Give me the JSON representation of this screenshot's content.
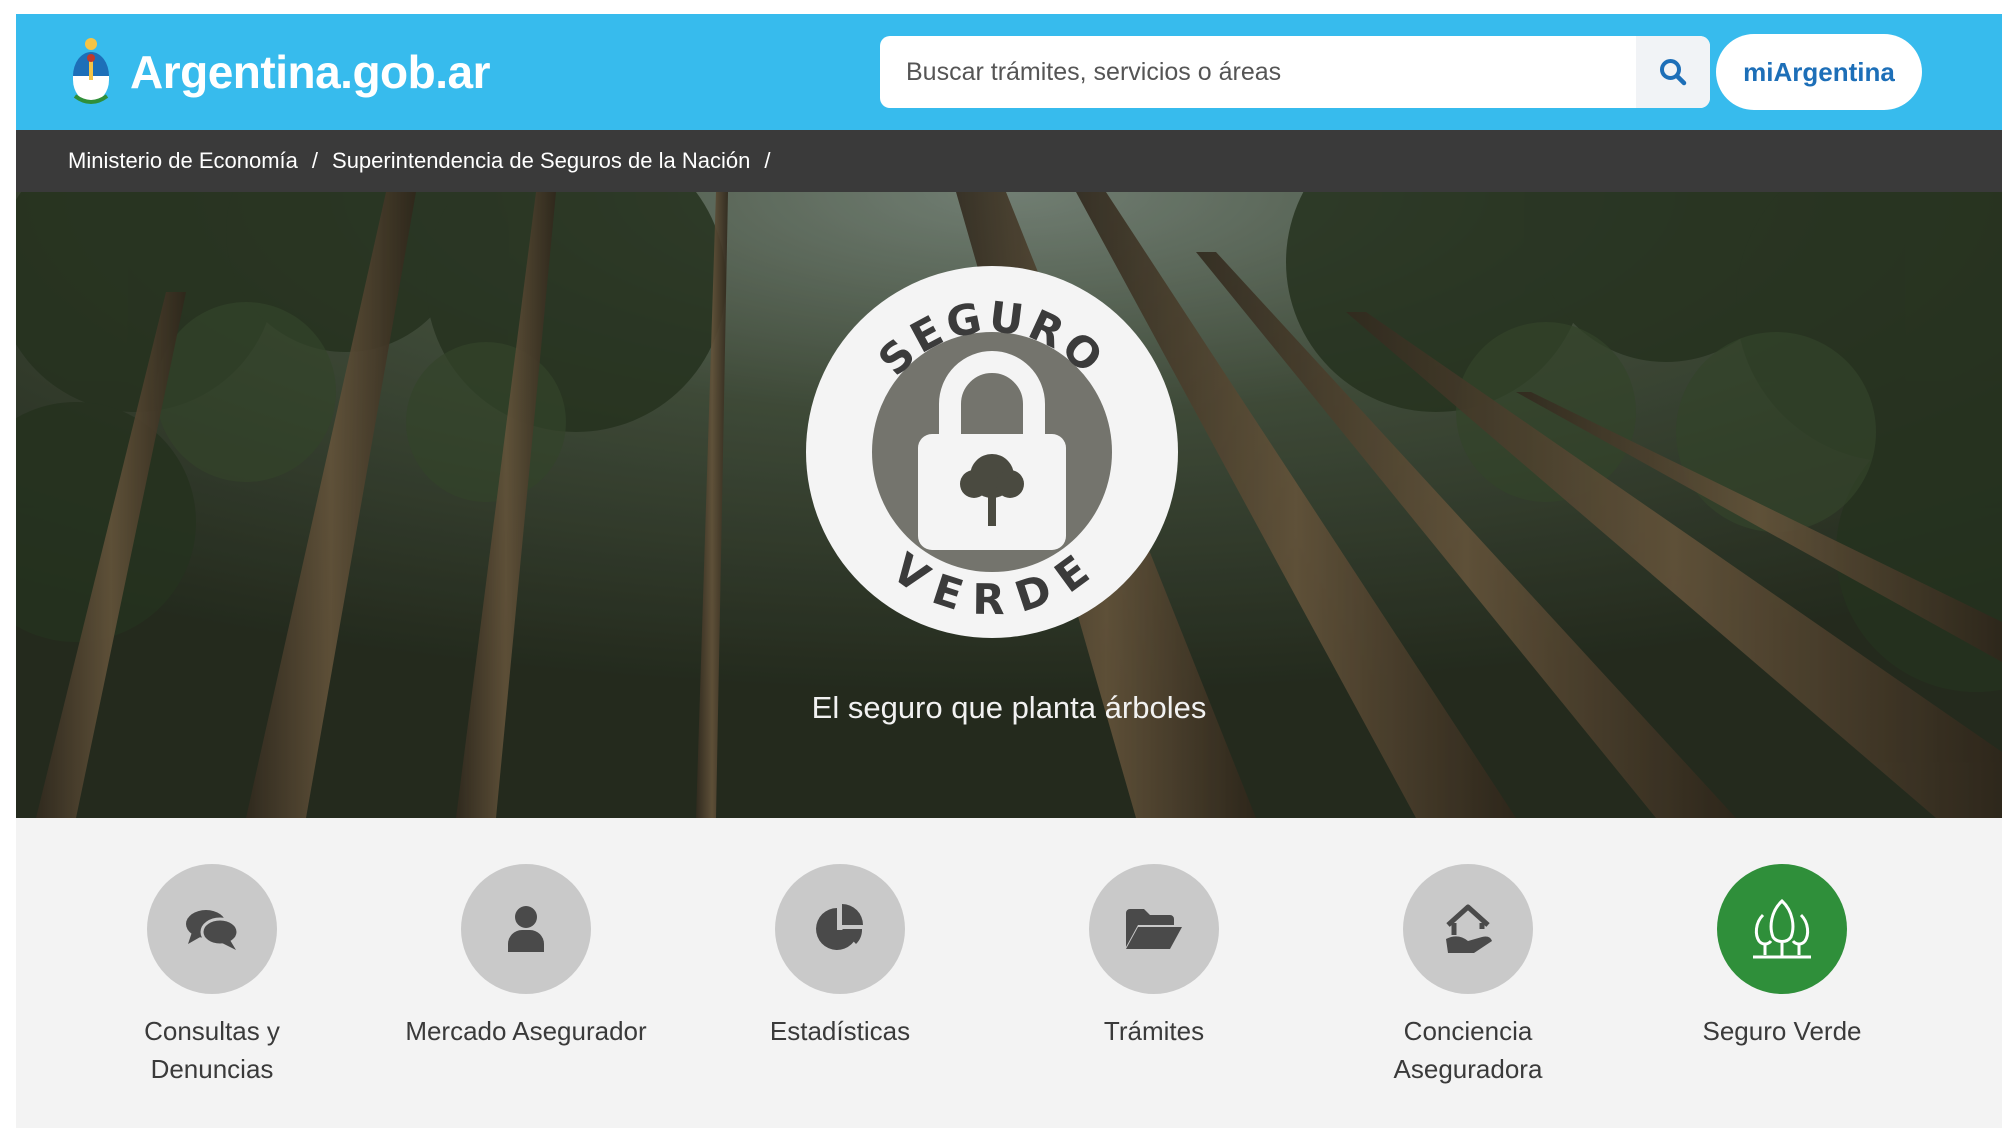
{
  "header": {
    "brand": "Argentina.gob.ar",
    "search_placeholder": "Buscar trámites, servicios o áreas",
    "login_label": "miArgentina"
  },
  "breadcrumb": {
    "items": [
      "Ministerio de Economía",
      "Superintendencia de Seguros de la Nación"
    ],
    "separator": "/"
  },
  "hero": {
    "badge_top": "SEGURO",
    "badge_bottom": "VERDE",
    "caption": "El seguro que planta árboles"
  },
  "quick_links": {
    "items": [
      {
        "label": "Consultas y Denuncias",
        "icon": "chat-icon"
      },
      {
        "label": "Mercado Asegurador",
        "icon": "user-icon"
      },
      {
        "label": "Estadísticas",
        "icon": "pie-chart-icon"
      },
      {
        "label": "Trámites",
        "icon": "folder-open-icon"
      },
      {
        "label": "Conciencia Aseguradora",
        "icon": "house-hand-icon"
      },
      {
        "label": "Seguro Verde",
        "icon": "trees-icon"
      }
    ]
  },
  "colors": {
    "header_bg": "#37bbed",
    "breadcrumb_bg": "#3a3a3a",
    "link_circle": "#c9c9c9",
    "active_circle": "#2f8f3a",
    "login_text": "#1d6fb8"
  }
}
